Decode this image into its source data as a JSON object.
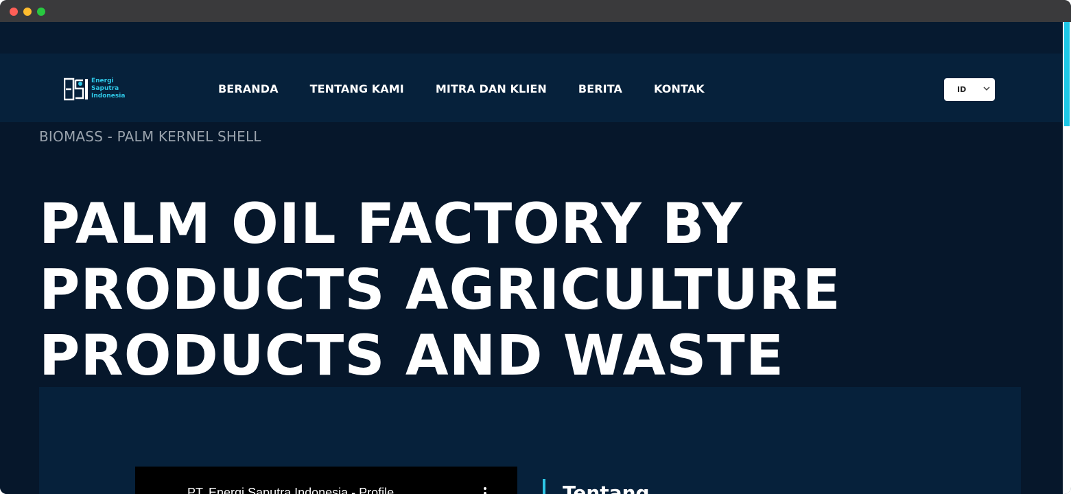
{
  "window": {
    "controls": [
      "close",
      "minimize",
      "maximize"
    ]
  },
  "logo": {
    "lines": [
      "Energi",
      "Saputra",
      "Indonesia"
    ],
    "mark_text": "ESI",
    "accent": "#2ec7e6"
  },
  "nav": {
    "items": [
      {
        "label": "BERANDA"
      },
      {
        "label": "TENTANG KAMI"
      },
      {
        "label": "MITRA DAN KLIEN"
      },
      {
        "label": "BERITA"
      },
      {
        "label": "KONTAK"
      }
    ]
  },
  "language": {
    "selected": "ID",
    "icon": "chevron-down-icon"
  },
  "breadcrumb": "BIOMASS - PALM KERNEL SHELL",
  "hero": {
    "lines": [
      "PALM OIL FACTORY BY",
      "PRODUCTS AGRICULTURE",
      "PRODUCTS AND WASTE"
    ]
  },
  "video": {
    "title": "PT. Energi Saputra Indonesia - Profile",
    "menu_icon": "more-vertical-icon"
  },
  "about": {
    "heading": "Tentang"
  },
  "colors": {
    "page_bg": "#06172b",
    "panel_bg": "#06213b",
    "accent": "#2ec7e6",
    "text": "#ffffff",
    "muted": "#9aa3ad"
  }
}
